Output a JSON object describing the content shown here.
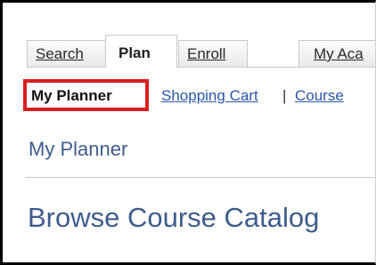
{
  "tabs": [
    {
      "label": "Search",
      "active": false
    },
    {
      "label": "Plan",
      "active": true
    },
    {
      "label": "Enroll",
      "active": false
    },
    {
      "label": "My Aca",
      "active": false
    }
  ],
  "subnav": {
    "current": "My Planner",
    "links": [
      "Shopping Cart",
      "Course"
    ],
    "separator": "|",
    "highlight_color": "#d81e1e"
  },
  "page_heading": "My Planner",
  "section_heading": "Browse Course Catalog",
  "colors": {
    "link": "#2b56a8",
    "heading": "#3e5c8c"
  }
}
